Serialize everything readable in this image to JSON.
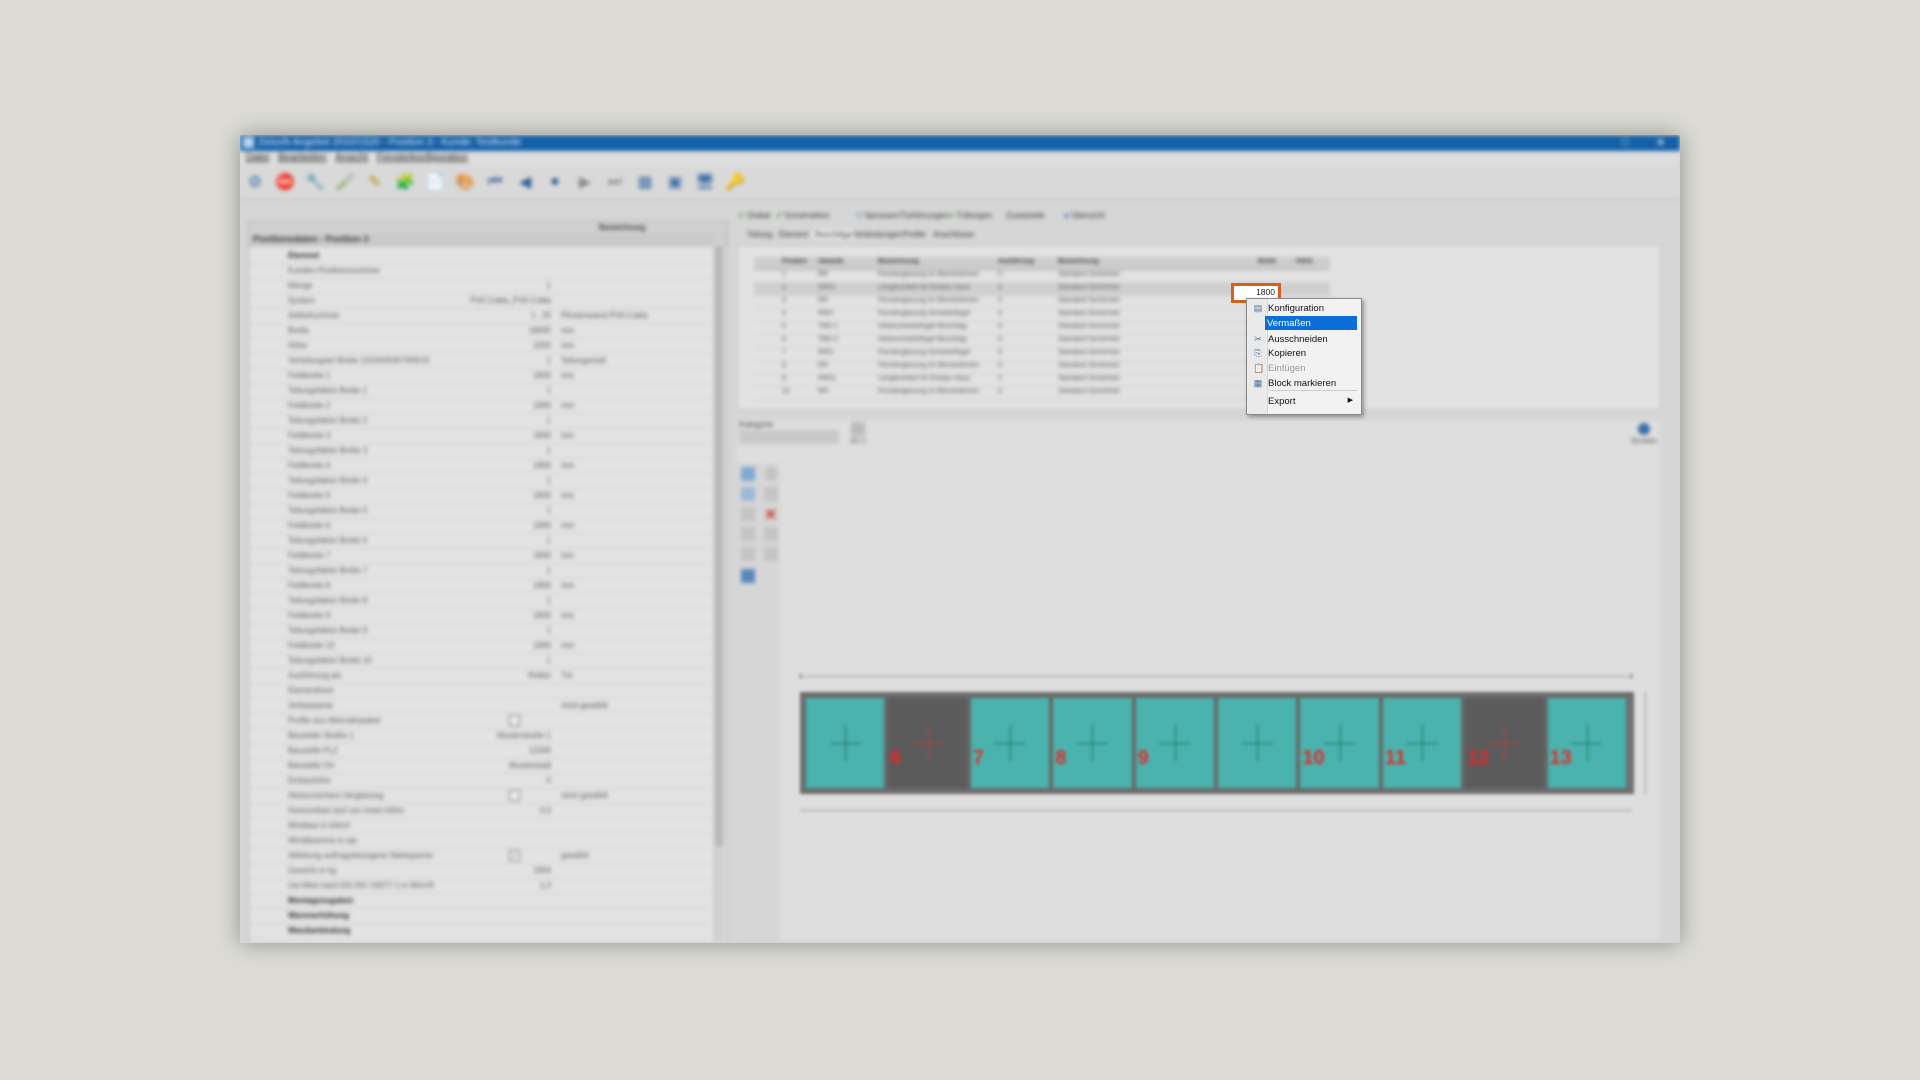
{
  "window": {
    "title": "Zeiss/b Angebot 2010/1520 - Position 3 - Kunde: Testkunde"
  },
  "menu": [
    "Datei",
    "Bearbeiten",
    "Ansicht",
    "Fensterkonfiguration"
  ],
  "toolbar_icons": [
    "gear-icon",
    "stop-icon",
    "tools-icon",
    "brush-icon",
    "pencil-icon",
    "puzzle-icon",
    "document-icon",
    "palette-icon",
    "first-icon",
    "prev-icon",
    "record-icon",
    "next-icon",
    "last-icon",
    "grid-icon",
    "window-icon",
    "monitor-icon",
    "key-icon"
  ],
  "left_panel": {
    "header_col": "Bezeichnung",
    "title": "Positionsdaten - Position 3",
    "rows": [
      {
        "label": "Element",
        "value": "",
        "unit": "",
        "section": true
      },
      {
        "label": "Kunden-Positionsnummer",
        "value": "",
        "unit": ""
      },
      {
        "label": "Menge",
        "value": "1",
        "unit": ""
      },
      {
        "label": "System",
        "value": "PVA Cobla_PVA Cobla",
        "unit": ""
      },
      {
        "label": "Artikelnummer",
        "value": "1 , 25",
        "unit": "Pfostenwand PVA Cobla"
      },
      {
        "label": "Breite",
        "value": "18000",
        "unit": "mm"
      },
      {
        "label": "Höhe",
        "value": "2250",
        "unit": "mm"
      },
      {
        "label": "Verteilung/art Breite 1/2/3/4/5/6/7/8/9/10",
        "value": "1",
        "unit": "Teilungsmaß"
      },
      {
        "label": "Feldbreite 1",
        "value": "1800",
        "unit": "mm"
      },
      {
        "label": "Teilungsfaktor Breite 1",
        "value": "1",
        "unit": ""
      },
      {
        "label": "Feldbreite 2",
        "value": "1800",
        "unit": "mm"
      },
      {
        "label": "Teilungsfaktor Breite 2",
        "value": "1",
        "unit": ""
      },
      {
        "label": "Feldbreite 3",
        "value": "1800",
        "unit": "mm"
      },
      {
        "label": "Teilungsfaktor Breite 3",
        "value": "1",
        "unit": ""
      },
      {
        "label": "Feldbreite 4",
        "value": "1800",
        "unit": "mm"
      },
      {
        "label": "Teilungsfaktor Breite 4",
        "value": "1",
        "unit": ""
      },
      {
        "label": "Feldbreite 5",
        "value": "1800",
        "unit": "mm"
      },
      {
        "label": "Teilungsfaktor Breite 5",
        "value": "1",
        "unit": ""
      },
      {
        "label": "Feldbreite 6",
        "value": "1800",
        "unit": "mm"
      },
      {
        "label": "Teilungsfaktor Breite 6",
        "value": "1",
        "unit": ""
      },
      {
        "label": "Feldbreite 7",
        "value": "1800",
        "unit": "mm"
      },
      {
        "label": "Teilungsfaktor Breite 7",
        "value": "1",
        "unit": ""
      },
      {
        "label": "Feldbreite 8",
        "value": "1800",
        "unit": "mm"
      },
      {
        "label": "Teilungsfaktor Breite 8",
        "value": "1",
        "unit": ""
      },
      {
        "label": "Feldbreite 9",
        "value": "1800",
        "unit": "mm"
      },
      {
        "label": "Teilungsfaktor Breite 9",
        "value": "1",
        "unit": ""
      },
      {
        "label": "Feldbreite 10",
        "value": "1800",
        "unit": "mm"
      },
      {
        "label": "Teilungsfaktor Breite 10",
        "value": "1",
        "unit": ""
      },
      {
        "label": "Ausführung als",
        "value": "Rollen",
        "unit": "Tür"
      },
      {
        "label": "Elementfront",
        "value": "",
        "unit": ""
      },
      {
        "label": "Verbaukante",
        "value": "",
        "unit": "nicht gewählt"
      },
      {
        "label": "Profile aus Alternativpaket",
        "value": "",
        "unit": "",
        "checkbox": true
      },
      {
        "label": "Baustelle Straße 1",
        "value": "Musterstraße 1",
        "unit": ""
      },
      {
        "label": "Baustelle PLZ",
        "value": "12345",
        "unit": ""
      },
      {
        "label": "Baustelle Ort",
        "value": "Musterstadt",
        "unit": ""
      },
      {
        "label": "Einbauhöhe",
        "value": "0",
        "unit": ""
      },
      {
        "label": "Absturzsichere Verglasung",
        "value": "",
        "unit": "nicht gewählt",
        "checkbox": true
      },
      {
        "label": "Horizontlast (auf von innen kN/m",
        "value": "0,0",
        "unit": ""
      },
      {
        "label": "Windlast in kN/m²",
        "value": "",
        "unit": ""
      },
      {
        "label": "Windlastzone in qw",
        "value": "",
        "unit": ""
      },
      {
        "label": "Ableitung auftragsbezogene Nahtspanne",
        "value": "",
        "unit": "gewählt",
        "checkbox": true,
        "checked": true
      },
      {
        "label": "Gewicht in kg",
        "value": "1954",
        "unit": ""
      },
      {
        "label": "Uw-Wert nach EN ISO 10077-1 in W/m²K",
        "value": "1,3",
        "unit": ""
      },
      {
        "label": "Montagezugaben",
        "value": "",
        "unit": "",
        "section": true
      },
      {
        "label": "Warenerhöhung",
        "value": "",
        "unit": "",
        "section": true
      },
      {
        "label": "Wandanbindung",
        "value": "",
        "unit": "",
        "section": true
      }
    ]
  },
  "tabs1": [
    "Global",
    "Konstruktion",
    "Sprossen/Türführungen",
    "Füllungen",
    "Zusatzteile",
    "Übersicht"
  ],
  "tabs2": [
    "Teilung",
    "Element",
    "Beschläge",
    "Verbindungen",
    "Profile",
    "Anschlüsse"
  ],
  "table": {
    "columns": [
      "Position",
      "Variante",
      "Bezeichnung",
      "Ausführung",
      "Bezeichnung",
      "Breite",
      "Höhe"
    ],
    "rows": [
      [
        "1",
        "RR",
        "Fensterglasung im Blendrahmen",
        "0",
        "Standard Sicherheit",
        "",
        ""
      ],
      [
        "2",
        "HR01",
        "Lenglemöbel für Einbau Haus",
        "0",
        "Standard Sicherheit",
        "",
        ""
      ],
      [
        "3",
        "RR",
        "Fensterglasung im Blendrahmen",
        "0",
        "Standard Sicherheit",
        "",
        ""
      ],
      [
        "4",
        "RRH",
        "Fensterglasung Schiebeflügel",
        "0",
        "Standard Sicherheit",
        "",
        ""
      ],
      [
        "5",
        "TBD-1",
        "Hebeschiebeflügel Beschlag",
        "0",
        "Standard Sicherheit",
        "",
        ""
      ],
      [
        "6",
        "TBD-2",
        "Hebeschiebeflügel Beschlag",
        "0",
        "Standard Sicherheit",
        "",
        ""
      ],
      [
        "7",
        "RRH",
        "Fensterglasung Schiebeflügel",
        "0",
        "Standard Sicherheit",
        "",
        ""
      ],
      [
        "8",
        "RR",
        "Fensterglasung im Blendrahmen",
        "0",
        "Standard Sicherheit",
        "",
        ""
      ],
      [
        "9",
        "HR01",
        "Lenglemöbel für Einbau Haus",
        "0",
        "Standard Sicherheit",
        "",
        ""
      ],
      [
        "10",
        "RR",
        "Fensterglasung im Blendrahmen",
        "0",
        "Standard Sicherheit",
        "",
        ""
      ]
    ],
    "editing_value": "1800"
  },
  "context_menu": {
    "items": [
      {
        "label": "Konfiguration",
        "icon": "config-icon",
        "state": "normal"
      },
      {
        "label": "Vermaßen",
        "icon": "",
        "state": "highlight"
      },
      {
        "label": "Ausschneiden",
        "icon": "scissors-icon",
        "state": "normal"
      },
      {
        "label": "Kopieren",
        "icon": "copy-icon",
        "state": "normal"
      },
      {
        "label": "Einfügen",
        "icon": "paste-icon",
        "state": "disabled"
      },
      {
        "label": "Block markieren",
        "icon": "block-icon",
        "state": "normal"
      },
      {
        "label": "Export",
        "icon": "",
        "state": "submenu"
      }
    ]
  },
  "lower_panel": {
    "label": "Kategorie",
    "right_button": "Drucken",
    "small_button": "3D-U"
  },
  "drawing": {
    "panes": [
      {
        "num": "",
        "type": "glass"
      },
      {
        "num": "6",
        "type": "door"
      },
      {
        "num": "7",
        "type": "glass"
      },
      {
        "num": "8",
        "type": "glass"
      },
      {
        "num": "9",
        "type": "slide"
      },
      {
        "num": "",
        "type": "slide"
      },
      {
        "num": "10",
        "type": "glass"
      },
      {
        "num": "11",
        "type": "glass"
      },
      {
        "num": "12",
        "type": "door"
      },
      {
        "num": "13",
        "type": "glass"
      }
    ],
    "colors": {
      "glass": "#4ab3ad",
      "door": "#5b5b5b",
      "number": "#e12a2a"
    }
  }
}
